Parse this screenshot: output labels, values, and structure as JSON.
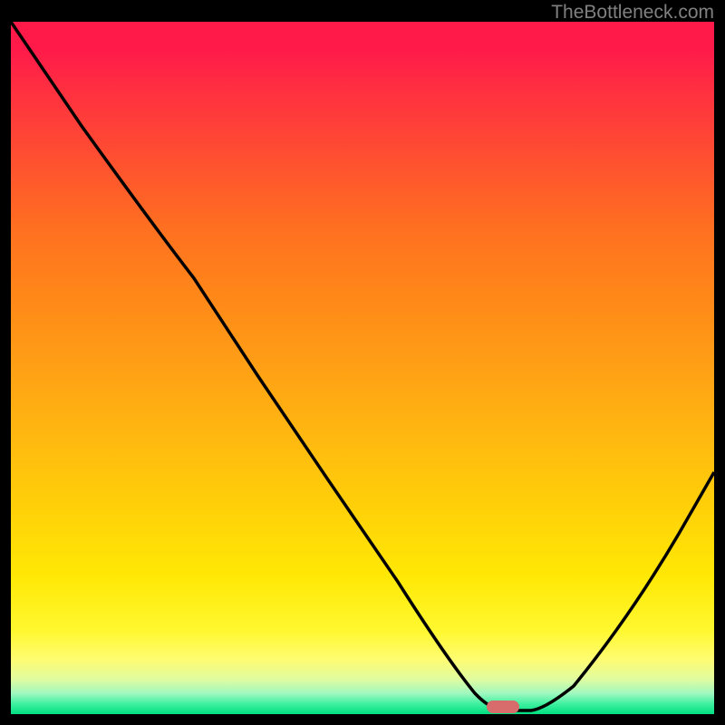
{
  "watermark": "TheBottleneck.com",
  "chart_data": {
    "type": "line",
    "title": "",
    "xlabel": "",
    "ylabel": "",
    "xlim": [
      0,
      100
    ],
    "ylim": [
      0,
      100
    ],
    "series": [
      {
        "name": "curve",
        "x": [
          0,
          10,
          20,
          26,
          35,
          45,
          55,
          62,
          66,
          70,
          74,
          80,
          88,
          95,
          100
        ],
        "y": [
          100,
          85,
          71,
          63,
          49,
          34,
          19,
          8,
          3,
          0.5,
          0.5,
          4,
          14,
          26,
          35
        ]
      }
    ],
    "marker": {
      "x": 70,
      "y": 0.5
    },
    "gradient_stops": [
      {
        "pos": 0,
        "color": "#ff1a4a"
      },
      {
        "pos": 50,
        "color": "#ffa015"
      },
      {
        "pos": 90,
        "color": "#fffa50"
      },
      {
        "pos": 100,
        "color": "#00e080"
      }
    ]
  }
}
